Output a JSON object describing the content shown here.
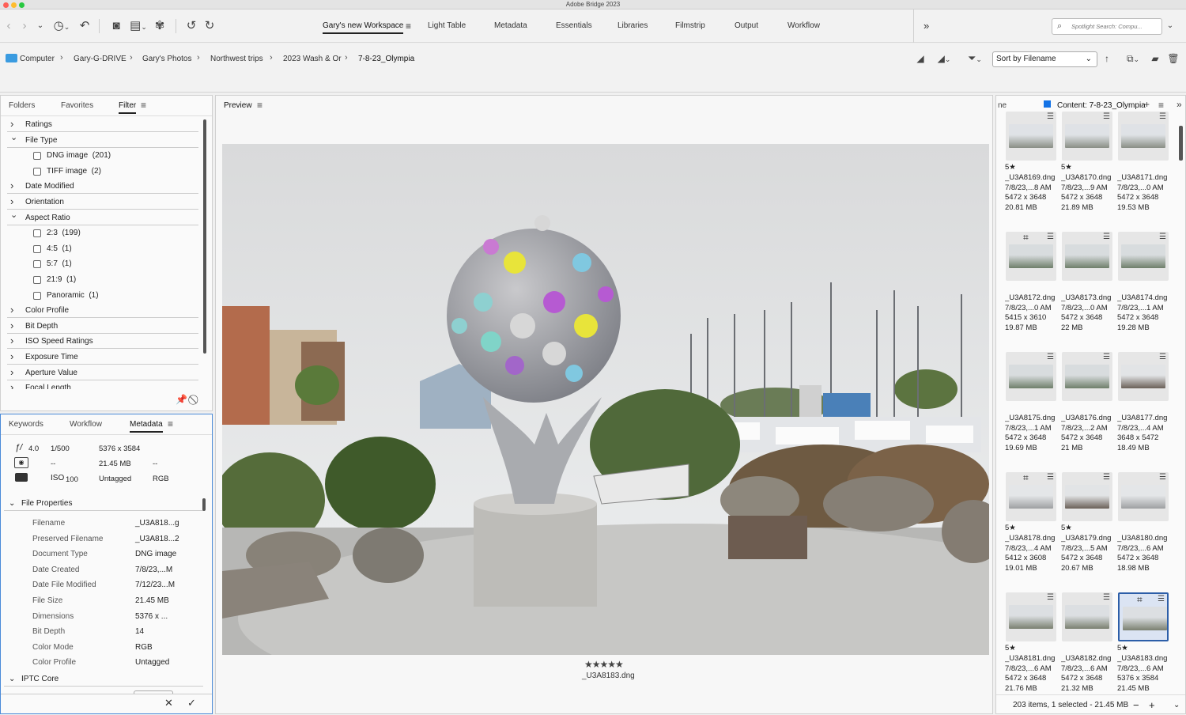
{
  "app_title": "Adobe Bridge 2023",
  "workspaces": [
    "Gary's new Workspace",
    "Light Table",
    "Metadata",
    "Essentials",
    "Libraries",
    "Filmstrip",
    "Output",
    "Workflow"
  ],
  "overflow_icon": "»",
  "search_placeholder": "Spotlight Search: Compu...",
  "breadcrumbs": [
    "Computer",
    "Gary-G-DRIVE",
    "Gary's Photos",
    "Northwest trips",
    "2023 Wash & Or",
    "7-8-23_Olympia"
  ],
  "sort_label": "Sort by Filename",
  "left_tabs": {
    "folders": "Folders",
    "favorites": "Favorites",
    "filter": "Filter"
  },
  "filter": [
    {
      "label": "Ratings",
      "expanded": false,
      "items": []
    },
    {
      "label": "File Type",
      "expanded": true,
      "items": [
        "DNG image  (201)",
        "TIFF image  (2)"
      ]
    },
    {
      "label": "Date Modified",
      "expanded": false,
      "items": []
    },
    {
      "label": "Orientation",
      "expanded": false,
      "items": []
    },
    {
      "label": "Aspect Ratio",
      "expanded": true,
      "items": [
        "2:3  (199)",
        "4:5  (1)",
        "5:7  (1)",
        "21:9  (1)",
        "Panoramic  (1)"
      ]
    },
    {
      "label": "Color Profile",
      "expanded": false,
      "items": []
    },
    {
      "label": "Bit Depth",
      "expanded": false,
      "items": []
    },
    {
      "label": "ISO Speed Ratings",
      "expanded": false,
      "items": []
    },
    {
      "label": "Exposure Time",
      "expanded": false,
      "items": []
    },
    {
      "label": "Aperture Value",
      "expanded": false,
      "items": []
    },
    {
      "label": "Focal Length",
      "expanded": false,
      "items": []
    }
  ],
  "meta_tabs": {
    "keywords": "Keywords",
    "workflow": "Workflow",
    "metadata": "Metadata"
  },
  "meta_summary": {
    "aperture": "4.0",
    "shutter": "1/500",
    "dims": "5376 x 3584",
    "size": "21.45 MB",
    "dash1": "--",
    "dash2": "--",
    "iso": "100",
    "iso_label": "ISO",
    "color": "Untagged",
    "mode": "RGB"
  },
  "file_props_header": "File Properties",
  "file_props": [
    {
      "k": "Filename",
      "v": "_U3A818...g"
    },
    {
      "k": "Preserved Filename",
      "v": "_U3A818...2"
    },
    {
      "k": "Document Type",
      "v": "DNG image"
    },
    {
      "k": "Date Created",
      "v": "7/8/23,...M"
    },
    {
      "k": "Date File Modified",
      "v": "7/12/23...M"
    },
    {
      "k": "File Size",
      "v": "21.45 MB"
    },
    {
      "k": "Dimensions",
      "v": "5376 x ..."
    },
    {
      "k": "Bit Depth",
      "v": "14"
    },
    {
      "k": "Color Mode",
      "v": "RGB"
    },
    {
      "k": "Color Profile",
      "v": "Untagged"
    }
  ],
  "iptc_header": "IPTC Core",
  "preview_label": "Preview",
  "preview_filename": "_U3A8183.dng",
  "preview_rating": "★★★★★",
  "content_title": "Content: 7-8-23_Olympia",
  "content_left_label": "ne",
  "thumbnails": [
    {
      "name": "_U3A8169.dng",
      "date": "7/8/23,...8 AM",
      "dims": "5472 x 3648",
      "size": "20.81 MB",
      "stars": "5★",
      "crop": false,
      "scene": "marina"
    },
    {
      "name": "_U3A8170.dng",
      "date": "7/8/23,...9 AM",
      "dims": "5472 x 3648",
      "size": "21.89 MB",
      "stars": "5★",
      "crop": false,
      "scene": "marina"
    },
    {
      "name": "_U3A8171.dng",
      "date": "7/8/23,...0 AM",
      "dims": "5472 x 3648",
      "size": "19.53 MB",
      "stars": "",
      "crop": false,
      "scene": "marina"
    },
    {
      "name": "_U3A8172.dng",
      "date": "7/8/23,...0 AM",
      "dims": "5415 x 3610",
      "size": "19.87 MB",
      "stars": "",
      "crop": true,
      "scene": "water"
    },
    {
      "name": "_U3A8173.dng",
      "date": "7/8/23,...0 AM",
      "dims": "5472 x 3648",
      "size": "22 MB",
      "stars": "",
      "crop": false,
      "scene": "water"
    },
    {
      "name": "_U3A8174.dng",
      "date": "7/8/23,...1 AM",
      "dims": "5472 x 3648",
      "size": "19.28 MB",
      "stars": "",
      "crop": false,
      "scene": "water"
    },
    {
      "name": "_U3A8175.dng",
      "date": "7/8/23,...1 AM",
      "dims": "5472 x 3648",
      "size": "19.69 MB",
      "stars": "",
      "crop": false,
      "scene": "water"
    },
    {
      "name": "_U3A8176.dng",
      "date": "7/8/23,...2 AM",
      "dims": "5472 x 3648",
      "size": "21 MB",
      "stars": "",
      "crop": false,
      "scene": "water"
    },
    {
      "name": "_U3A8177.dng",
      "date": "7/8/23,...4 AM",
      "dims": "3648 x 5472",
      "size": "18.49 MB",
      "stars": "",
      "crop": false,
      "scene": "tower"
    },
    {
      "name": "_U3A8178.dng",
      "date": "7/8/23,...4 AM",
      "dims": "5412 x 3608",
      "size": "19.01 MB",
      "stars": "5★",
      "crop": true,
      "scene": "plain"
    },
    {
      "name": "_U3A8179.dng",
      "date": "7/8/23,...5 AM",
      "dims": "5472 x 3648",
      "size": "20.67 MB",
      "stars": "5★",
      "crop": false,
      "scene": "tower"
    },
    {
      "name": "_U3A8180.dng",
      "date": "7/8/23,...6 AM",
      "dims": "5472 x 3648",
      "size": "18.98 MB",
      "stars": "",
      "crop": false,
      "scene": "plain"
    },
    {
      "name": "_U3A8181.dng",
      "date": "7/8/23,...6 AM",
      "dims": "5472 x 3648",
      "size": "21.76 MB",
      "stars": "5★",
      "crop": false,
      "scene": "sphere"
    },
    {
      "name": "_U3A8182.dng",
      "date": "7/8/23,...6 AM",
      "dims": "5472 x 3648",
      "size": "21.32 MB",
      "stars": "",
      "crop": false,
      "scene": "sphere"
    },
    {
      "name": "_U3A8183.dng",
      "date": "7/8/23,...6 AM",
      "dims": "5376 x 3584",
      "size": "21.45 MB",
      "stars": "5★",
      "crop": true,
      "scene": "sphere",
      "selected": true
    }
  ],
  "status_text": "203 items, 1 selected - 21.45 MB",
  "colors": {
    "accent": "#1473e6",
    "selection": "#2c5ea8"
  }
}
